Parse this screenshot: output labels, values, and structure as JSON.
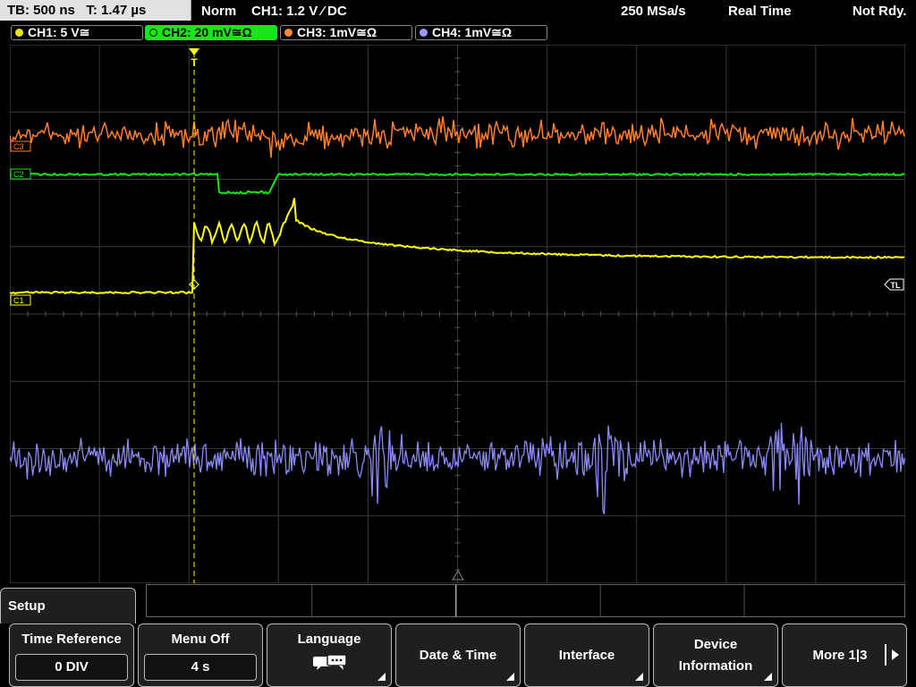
{
  "status_bar": {
    "timebase": "TB: 500 ns   T: 1.47 µs",
    "trigger_mode": "Norm",
    "trigger_info": "CH1: 1.2 V ⁄ DC",
    "sample_rate": "250 MSa/s",
    "acquisition_mode": "Real Time",
    "status": "Not Rdy."
  },
  "channels": [
    {
      "label": "CH1: 5 V≅",
      "color": "#f2e600",
      "trace_color": "#ffff00"
    },
    {
      "label": "CH2: 20 mV≅Ω",
      "color": "#19e619",
      "trace_color": "#14e614"
    },
    {
      "label": "CH3: 1mV≅Ω",
      "color": "#ff8833",
      "trace_color": "#ff7f27"
    },
    {
      "label": "CH4: 1mV≅Ω",
      "color": "#9999ff",
      "trace_color": "#8a8af5"
    }
  ],
  "markers": {
    "trigger_marker": "T",
    "trigger_level_marker": "TL",
    "ch1_marker": "C1",
    "ch2_marker": "C2",
    "ch3_marker": "C3"
  },
  "menu": {
    "title": "Setup",
    "softkeys": [
      {
        "label": "Time Reference",
        "value": "0 DIV"
      },
      {
        "label": "Menu Off",
        "value": "4 s"
      },
      {
        "label": "Language",
        "icon": "speech-bubbles-icon"
      },
      {
        "label": "Date & Time"
      },
      {
        "label": "Interface"
      },
      {
        "label1": "Device",
        "label2": "Information"
      },
      {
        "label": "More 1|3"
      }
    ]
  },
  "colors": {
    "grid": "#3a3a3a",
    "trigger_line": "#ffff00",
    "background": "#000000"
  }
}
